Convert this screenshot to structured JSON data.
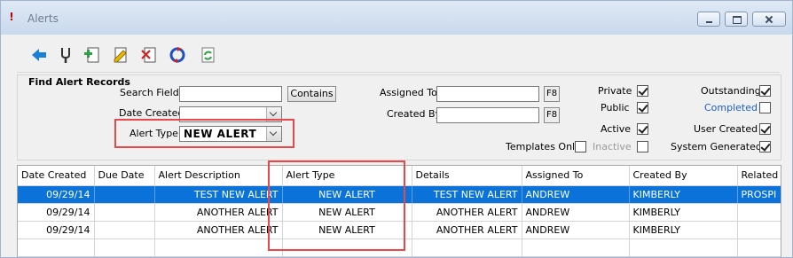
{
  "window": {
    "title": "Alerts",
    "title_icon": "exclamation-icon",
    "controls": [
      "minimize",
      "maximize",
      "close"
    ]
  },
  "toolbar": {
    "buttons": [
      {
        "name": "back-arrow-icon",
        "color": "#1a7fd6"
      },
      {
        "name": "tuning-fork-icon",
        "color": "#333333"
      },
      {
        "name": "add-document-icon",
        "color": "#2ea043"
      },
      {
        "name": "edit-document-icon",
        "color": "#d9a400"
      },
      {
        "name": "delete-document-icon",
        "color": "#d02020"
      },
      {
        "name": "refresh-cycle-icon",
        "color": "#2050c0"
      },
      {
        "name": "refresh-green-icon",
        "color": "#2ea043"
      }
    ]
  },
  "filters": {
    "title": "Find Alert Records",
    "search_fields_label": "Search Fields",
    "search_fields_value": "",
    "contains_button": "Contains",
    "date_created_label": "Date Created",
    "date_created_value": "",
    "alert_type_label": "Alert Type",
    "alert_type_value": "NEW ALERT",
    "assigned_to_label": "Assigned To",
    "assigned_to_value": "",
    "assigned_to_lookup": "F8",
    "created_by_label": "Created By",
    "created_by_value": "",
    "created_by_lookup": "F8",
    "templates_only_label": "Templates Only",
    "templates_only": false,
    "private_label": "Private",
    "private": true,
    "public_label": "Public",
    "public": true,
    "active_label": "Active",
    "active": true,
    "inactive_label": "Inactive",
    "inactive": false,
    "outstanding_label": "Outstanding",
    "outstanding": true,
    "completed_label": "Completed",
    "completed": false,
    "user_created_label": "User Created",
    "user_created": true,
    "system_generated_label": "System Generated",
    "system_generated": true
  },
  "grid": {
    "columns": [
      "Date Created",
      "Due Date",
      "Alert Description",
      "Alert Type",
      "Details",
      "Assigned To",
      "Created By",
      "Related"
    ],
    "rows": [
      {
        "date_created": "09/29/14",
        "due_date": "",
        "description": "TEST NEW ALERT",
        "alert_type": "NEW ALERT",
        "details": "TEST NEW ALERT",
        "assigned_to": "ANDREW",
        "created_by": "KIMBERLY",
        "related": "PROSPI",
        "selected": true
      },
      {
        "date_created": "09/29/14",
        "due_date": "",
        "description": "ANOTHER ALERT",
        "alert_type": "NEW ALERT",
        "details": "ANOTHER ALERT",
        "assigned_to": "ANDREW",
        "created_by": "KIMBERLY",
        "related": "",
        "selected": false
      },
      {
        "date_created": "09/29/14",
        "due_date": "",
        "description": "ANOTHER ALERT",
        "alert_type": "NEW ALERT",
        "details": "ANOTHER ALERT",
        "assigned_to": "ANDREW",
        "created_by": "KIMBERLY",
        "related": "",
        "selected": false
      }
    ]
  },
  "colors": {
    "selection": "#0a72d8",
    "highlight": "#e8484a",
    "link": "#1a5fc8"
  }
}
